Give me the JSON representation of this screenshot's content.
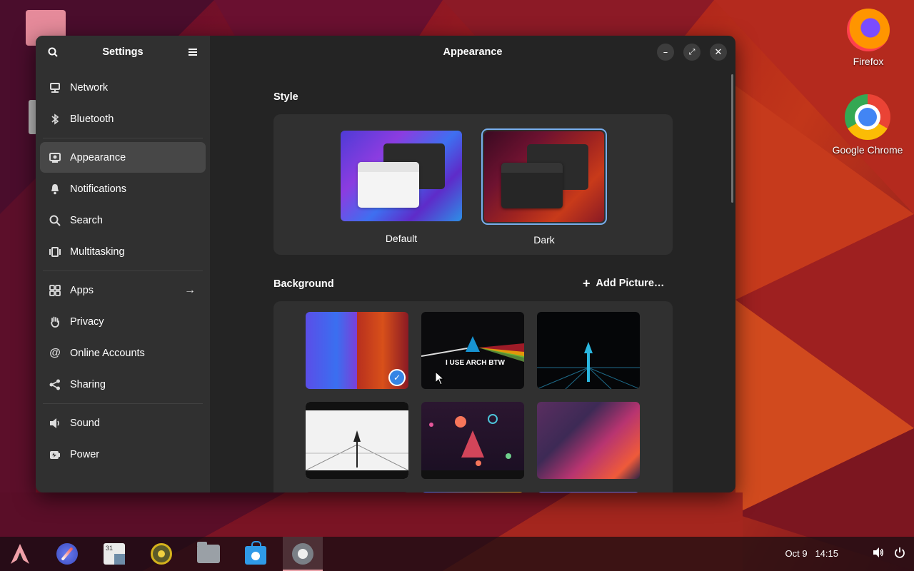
{
  "desktop": {
    "icons": [
      {
        "label": "Firefox"
      },
      {
        "label": "Google Chrome"
      }
    ]
  },
  "settings": {
    "sidebar_title": "Settings",
    "window_title": "Appearance",
    "sidebar_items": [
      {
        "label": "Network",
        "icon": "network-icon"
      },
      {
        "label": "Bluetooth",
        "icon": "bluetooth-icon"
      },
      {
        "label": "Appearance",
        "icon": "appearance-icon",
        "active": true
      },
      {
        "label": "Notifications",
        "icon": "bell-icon"
      },
      {
        "label": "Search",
        "icon": "search-icon"
      },
      {
        "label": "Multitasking",
        "icon": "multitasking-icon"
      },
      {
        "label": "Apps",
        "icon": "apps-icon"
      },
      {
        "label": "Privacy",
        "icon": "hand-icon"
      },
      {
        "label": "Online Accounts",
        "icon": "at-icon"
      },
      {
        "label": "Sharing",
        "icon": "share-icon"
      },
      {
        "label": "Sound",
        "icon": "speaker-icon"
      },
      {
        "label": "Power",
        "icon": "power-icon"
      }
    ],
    "style": {
      "heading": "Style",
      "options": [
        {
          "label": "Default",
          "selected": false
        },
        {
          "label": "Dark",
          "selected": true
        }
      ]
    },
    "background": {
      "heading": "Background",
      "add_label": "Add Picture…",
      "arch_text": "I USE ARCH BTW"
    }
  },
  "taskbar": {
    "date": "Oct 9",
    "time": "14:15"
  },
  "colors": {
    "accent": "#78aeed",
    "window_bg": "#242424",
    "sidebar_bg": "#303030"
  }
}
